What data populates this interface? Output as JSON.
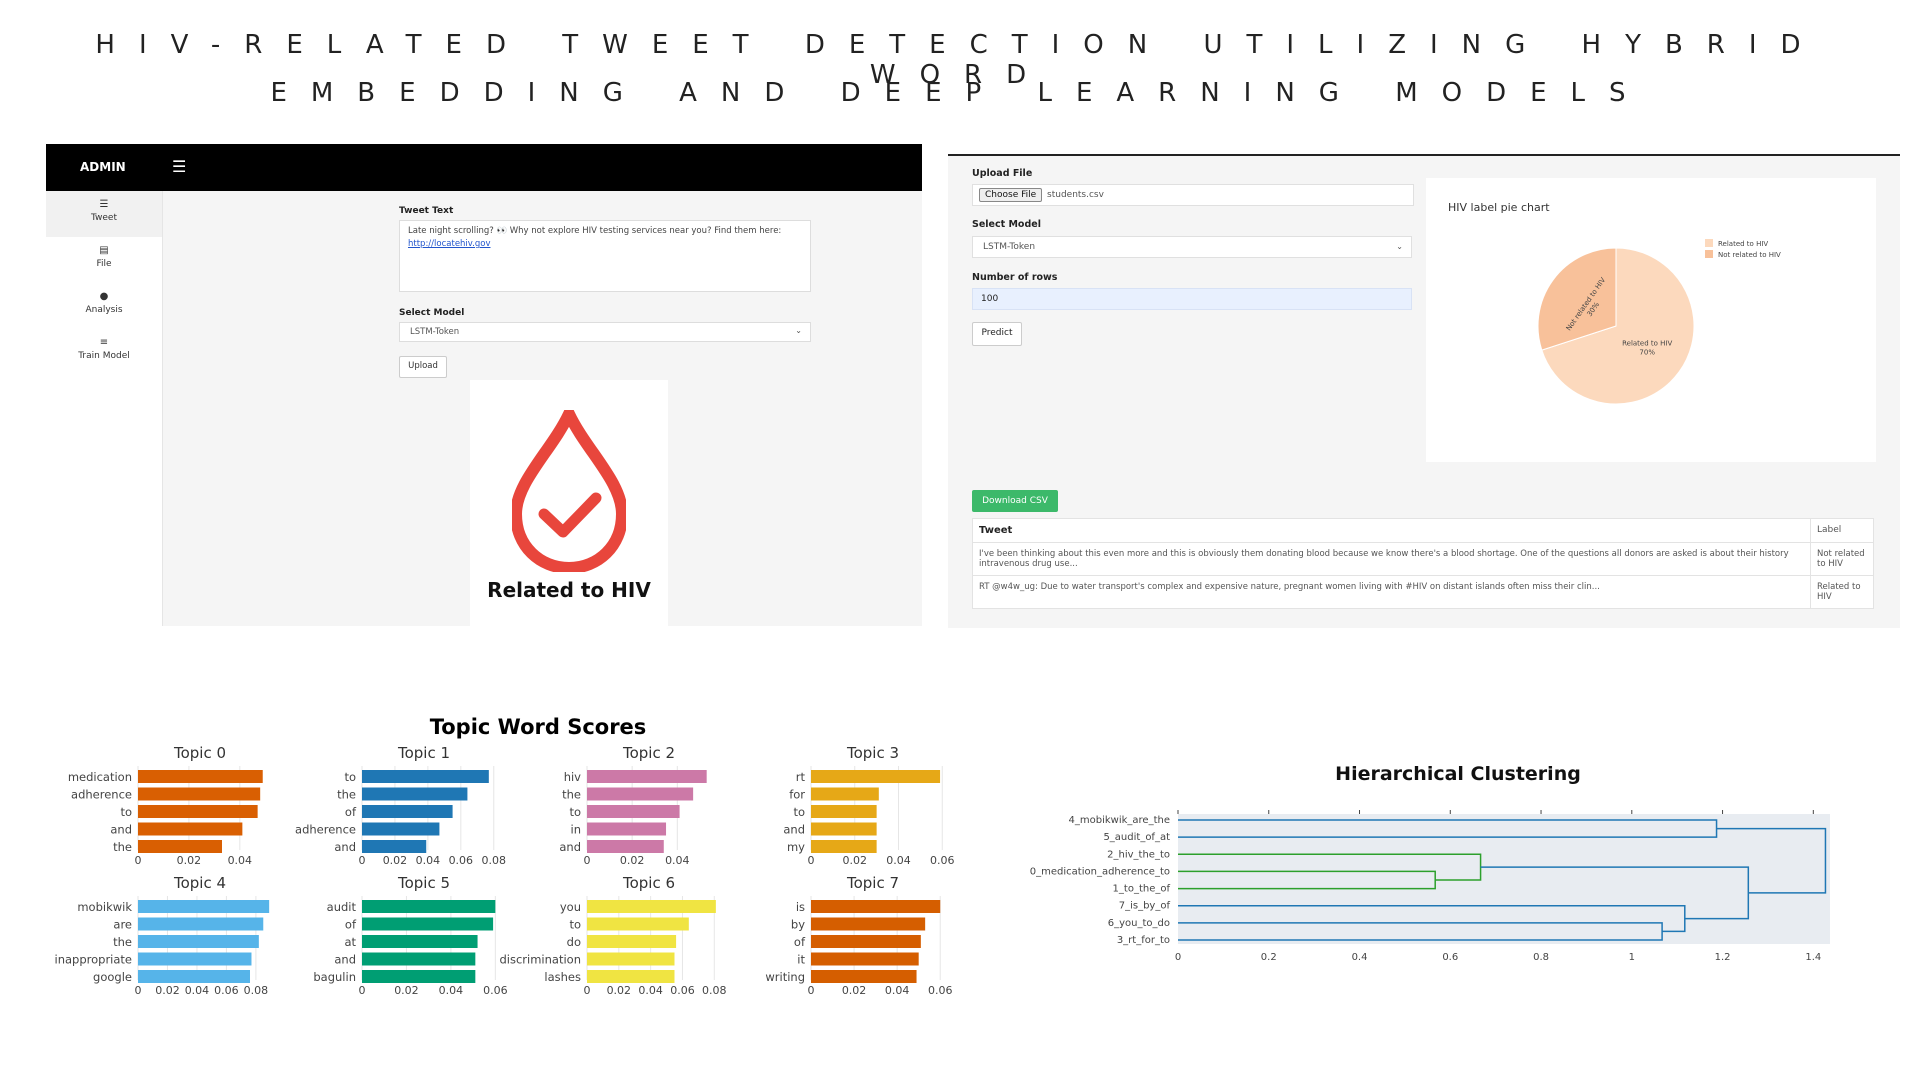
{
  "title_line1": "HIV-RELATED TWEET DETECTION UTILIZING HYBRID WORD",
  "title_line2": "EMBEDDING AND DEEP LEARNING MODELS",
  "admin_panel": {
    "brand": "ADMIN",
    "sidebar": [
      {
        "label": "Tweet",
        "icon": "list-icon",
        "glyph": "☰"
      },
      {
        "label": "File",
        "icon": "file-icon",
        "glyph": "▤"
      },
      {
        "label": "Analysis",
        "icon": "info-icon",
        "glyph": "●"
      },
      {
        "label": "Train Model",
        "icon": "list-icon",
        "glyph": "≡"
      }
    ],
    "tweet_text_label": "Tweet Text",
    "tweet_text": "Late night scrolling? 👀 Why not explore HIV testing services near you? Find them here:",
    "tweet_link": "http://locatehiv.gov",
    "select_model_label": "Select Model",
    "selected_model": "LSTM-Token",
    "upload_button": "Upload",
    "result_text": "Related to HIV",
    "result_color": "#e8463c"
  },
  "file_panel": {
    "upload_file_label": "Upload File",
    "choose_file_button": "Choose File",
    "file_name": "students.csv",
    "select_model_label": "Select Model",
    "selected_model": "LSTM-Token",
    "rows_label": "Number of rows",
    "rows_value": "100",
    "predict_button": "Predict",
    "pie_title": "HIV label pie chart",
    "download_button": "Download CSV",
    "table_headers": [
      "Tweet",
      "Label"
    ],
    "table_rows": [
      [
        "I've been thinking about this even more and this is obviously them donating blood because we know there's a blood shortage. One of the questions all donors are asked is about their history intravenous drug use...",
        "Not related to HIV"
      ],
      [
        "RT @w4w_ug: Due to water transport's complex and expensive nature, pregnant women living with #HIV on distant islands often miss their clin...",
        "Related to HIV"
      ]
    ]
  },
  "chart_data": [
    {
      "type": "pie",
      "title": "HIV label pie chart",
      "labels": [
        "Related to HIV",
        "Not related to HIV"
      ],
      "values": [
        70,
        30
      ],
      "slice_text": [
        "Related to HIV\n70%",
        "Not related to HIV\n30%"
      ],
      "colors": [
        "#fcd9bd",
        "#f8c19a"
      ],
      "legend": "top-right"
    },
    {
      "type": "bar",
      "title": "Topic Word Scores",
      "orientation": "horizontal",
      "panels": [
        {
          "name": "Topic 0",
          "color": "#d95f02",
          "words": [
            "medication",
            "adherence",
            "to",
            "and",
            "the"
          ],
          "values": [
            0.049,
            0.048,
            0.047,
            0.041,
            0.033
          ],
          "ticks": [
            "0",
            "0.02",
            "0.04"
          ],
          "xmax": 0.055
        },
        {
          "name": "Topic 1",
          "color": "#1f77b4",
          "words": [
            "to",
            "the",
            "of",
            "adherence",
            "and"
          ],
          "values": [
            0.077,
            0.064,
            0.055,
            0.047,
            0.039
          ],
          "ticks": [
            "0",
            "0.02",
            "0.04",
            "0.06",
            "0.08"
          ],
          "xmax": 0.085
        },
        {
          "name": "Topic 2",
          "color": "#cc79a7",
          "words": [
            "hiv",
            "the",
            "to",
            "in",
            "and"
          ],
          "values": [
            0.053,
            0.047,
            0.041,
            0.035,
            0.034
          ],
          "ticks": [
            "0",
            "0.02",
            "0.04"
          ],
          "xmax": 0.062
        },
        {
          "name": "Topic 3",
          "color": "#e6a817",
          "words": [
            "rt",
            "for",
            "to",
            "and",
            "my"
          ],
          "values": [
            0.059,
            0.031,
            0.03,
            0.03,
            0.03
          ],
          "ticks": [
            "0",
            "0.02",
            "0.04",
            "0.06"
          ],
          "xmax": 0.064
        },
        {
          "name": "Topic 4",
          "color": "#56b4e9",
          "words": [
            "mobikwik",
            "are",
            "the",
            "inappropriate",
            "google"
          ],
          "values": [
            0.089,
            0.085,
            0.082,
            0.077,
            0.076
          ],
          "ticks": [
            "0",
            "0.02",
            "0.04",
            "0.06",
            "0.08"
          ],
          "xmax": 0.095
        },
        {
          "name": "Topic 5",
          "color": "#009e73",
          "words": [
            "audit",
            "of",
            "at",
            "and",
            "bagulin"
          ],
          "values": [
            0.06,
            0.059,
            0.052,
            0.051,
            0.051
          ],
          "ticks": [
            "0",
            "0.02",
            "0.04",
            "0.06"
          ],
          "xmax": 0.063
        },
        {
          "name": "Topic 6",
          "color": "#f0e442",
          "words": [
            "you",
            "to",
            "do",
            "discrimination",
            "lashes"
          ],
          "values": [
            0.081,
            0.064,
            0.056,
            0.055,
            0.055
          ],
          "ticks": [
            "0",
            "0.02",
            "0.04",
            "0.06",
            "0.08"
          ],
          "xmax": 0.088
        },
        {
          "name": "Topic 7",
          "color": "#d55e00",
          "words": [
            "is",
            "by",
            "of",
            "it",
            "writing"
          ],
          "values": [
            0.06,
            0.053,
            0.051,
            0.05,
            0.049
          ],
          "ticks": [
            "0",
            "0.02",
            "0.04",
            "0.06"
          ],
          "xmax": 0.065
        }
      ]
    },
    {
      "type": "dendrogram",
      "title": "Hierarchical Clustering",
      "leaves": [
        "4_mobikwik_are_the",
        "5_audit_of_at",
        "2_hiv_the_to",
        "0_medication_adherence_to",
        "1_to_the_of",
        "7_is_by_of",
        "6_you_to_do",
        "3_rt_for_to"
      ],
      "merges": [
        {
          "a": 0,
          "b": 1,
          "height": 1.2,
          "color": "#1f77b4"
        },
        {
          "a": 3,
          "b": 4,
          "height": 0.58,
          "color": "#2ca02c"
        },
        {
          "a": 2,
          "b": "m1",
          "height": 0.68,
          "color": "#2ca02c"
        },
        {
          "a": 6,
          "b": 7,
          "height": 1.08,
          "color": "#1f77b4"
        },
        {
          "a": 5,
          "b": "m3",
          "height": 1.13,
          "color": "#1f77b4"
        },
        {
          "a": "m2",
          "b": "m4",
          "height": 1.27,
          "color": "#1f77b4"
        },
        {
          "a": "m0",
          "b": "m5",
          "height": 1.44,
          "color": "#1f77b4"
        }
      ],
      "x_ticks": [
        "0",
        "0.2",
        "0.4",
        "0.6",
        "0.8",
        "1",
        "1.2",
        "1.4"
      ],
      "xlim": [
        0,
        1.45
      ]
    }
  ]
}
